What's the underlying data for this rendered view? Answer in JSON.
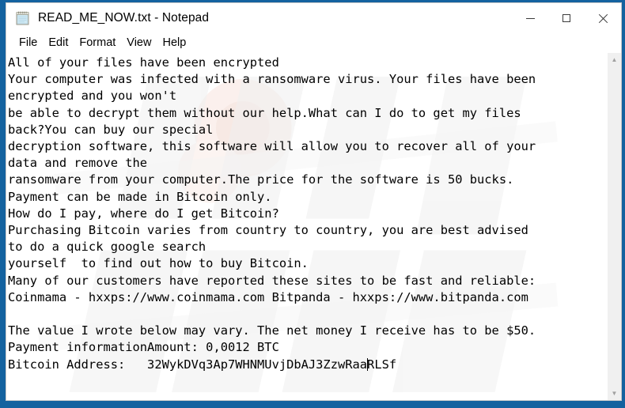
{
  "window": {
    "title": "READ_ME_NOW.txt - Notepad",
    "icon": "notepad-icon",
    "controls": {
      "minimize": "minimize-icon",
      "maximize": "maximize-icon",
      "close": "close-icon"
    }
  },
  "menu": {
    "items": [
      {
        "label": "File"
      },
      {
        "label": "Edit"
      },
      {
        "label": "Format"
      },
      {
        "label": "View"
      },
      {
        "label": "Help"
      }
    ]
  },
  "editor": {
    "lines_before_caret": "All of your files have been encrypted\nYour computer was infected with a ransomware virus. Your files have been\nencrypted and you won't\nbe able to decrypt them without our help.What can I do to get my files\nback?You can buy our special\ndecryption software, this software will allow you to recover all of your\ndata and remove the\nransomware from your computer.The price for the software is 50 bucks.\nPayment can be made in Bitcoin only.\nHow do I pay, where do I get Bitcoin?\nPurchasing Bitcoin varies from country to country, you are best advised\nto do a quick google search\nyourself  to find out how to buy Bitcoin.\nMany of our customers have reported these sites to be fast and reliable:\nCoinmama - hxxps://www.coinmama.com Bitpanda - hxxps://www.bitpanda.com\n\nThe value I wrote below may vary. The net money I receive has to be $50.\nPayment informationAmount: 0,0012 BTC\nBitcoin Address:   32WykDVq3Ap7WHNMUvjDbAJ3ZzwRaa",
    "lines_after_caret": "RLSf",
    "full_text": "All of your files have been encrypted\nYour computer was infected with a ransomware virus. Your files have been\nencrypted and you won't\nbe able to decrypt them without our help.What can I do to get my files\nback?You can buy our special\ndecryption software, this software will allow you to recover all of your\ndata and remove the\nransomware from your computer.The price for the software is 50 bucks.\nPayment can be made in Bitcoin only.\nHow do I pay, where do I get Bitcoin?\nPurchasing Bitcoin varies from country to country, you are best advised\nto do a quick google search\nyourself  to find out how to buy Bitcoin.\nMany of our customers have reported these sites to be fast and reliable:\nCoinmama - hxxps://www.coinmama.com Bitpanda - hxxps://www.bitpanda.com\n\nThe value I wrote below may vary. The net money I receive has to be $50.\nPayment informationAmount: 0,0012 BTC\nBitcoin Address:   32WykDVq3Ap7WHNMUvjDbAJ3ZzwRaaRLSf",
    "ransom_details": {
      "price_usd_text": "50 bucks",
      "net_amount_text": "$50",
      "amount_btc": "0,0012 BTC",
      "bitcoin_address": "32WykDVq3Ap7WHNMUvjDbAJ3ZzwRaaRLSf",
      "exchange_1": "Coinmama - hxxps://www.coinmama.com",
      "exchange_2": "Bitpanda - hxxps://www.bitpanda.com"
    }
  },
  "scrollbar": {
    "up_arrow": "chevron-up-icon",
    "down_arrow": "chevron-down-icon"
  },
  "colors": {
    "desktop": "#14629f",
    "window_bg": "#ffffff",
    "text": "#000000",
    "scrollbar_track": "#f0f0f0"
  }
}
